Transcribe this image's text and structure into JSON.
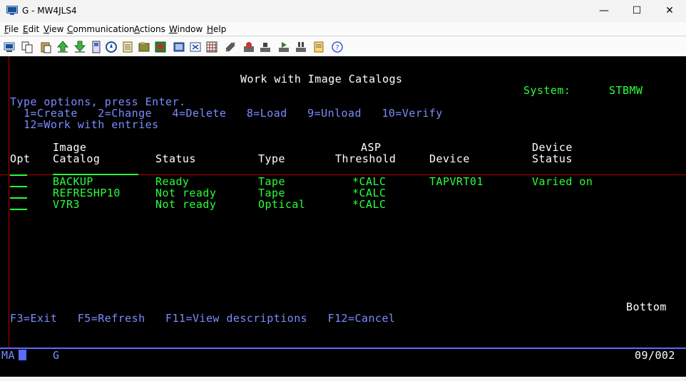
{
  "window": {
    "title": "G - MW4JLS4",
    "minimize_glyph": "—",
    "maximize_glyph": "☐",
    "close_glyph": "✕"
  },
  "menu": {
    "items": [
      {
        "first": "F",
        "rest": "ile"
      },
      {
        "first": "E",
        "rest": "dit"
      },
      {
        "first": "V",
        "rest": "iew"
      },
      {
        "first": "C",
        "rest": "ommunication"
      },
      {
        "first": "A",
        "rest": "ctions"
      },
      {
        "first": "W",
        "rest": "indow"
      },
      {
        "first": "H",
        "rest": "elp"
      }
    ]
  },
  "toolbar": {
    "icons": [
      "print-screen-icon",
      "copy-icon",
      "paste-icon",
      "send-file-icon",
      "receive-file-icon",
      "display-session-icon",
      "navigator-icon",
      "clipboard-icon",
      "macro-icon",
      "map-icon",
      "keypad-icon",
      "edit-icon",
      "grid-icon",
      "macro-record-icon",
      "record-icon",
      "stop-icon",
      "play-icon",
      "pause-icon",
      "notes-icon",
      "help-icon"
    ]
  },
  "screen": {
    "title": "Work with Image Catalogs",
    "system_label": "System:",
    "system_value": "STBMW",
    "instructions": "Type options, press Enter.",
    "options_line1": "  1=Create   2=Change   4=Delete   8=Load   9=Unload   10=Verify",
    "options_line2": "  12=Work with entries",
    "headers": {
      "image_top": "Image",
      "asp_top": "ASP",
      "device_top": "Device",
      "opt": "Opt",
      "catalog": "Catalog",
      "status": "Status",
      "type": "Type",
      "threshold": "Threshold",
      "device": "Device",
      "device_status": "Status"
    },
    "rows": [
      {
        "catalog": "BACKUP",
        "status": "Ready",
        "type": "Tape",
        "threshold": "*CALC",
        "device": "TAPVRT01",
        "device_status": "Varied on"
      },
      {
        "catalog": "REFRESHP10",
        "status": "Not ready",
        "type": "Tape",
        "threshold": "*CALC",
        "device": "",
        "device_status": ""
      },
      {
        "catalog": "V7R3",
        "status": "Not ready",
        "type": "Optical",
        "threshold": "*CALC",
        "device": "",
        "device_status": ""
      }
    ],
    "more_indicator": "Bottom",
    "function_keys": "F3=Exit   F5=Refresh   F11=View descriptions   F12=Cancel"
  },
  "oia": {
    "session_indicator": "MA",
    "screen_id": "G",
    "cursor_position": "09/002"
  },
  "colors": {
    "green": "#29ff3a",
    "blue": "#7b8cff",
    "white": "#ffffff",
    "background": "#000000",
    "crosshair": "#b00000"
  }
}
